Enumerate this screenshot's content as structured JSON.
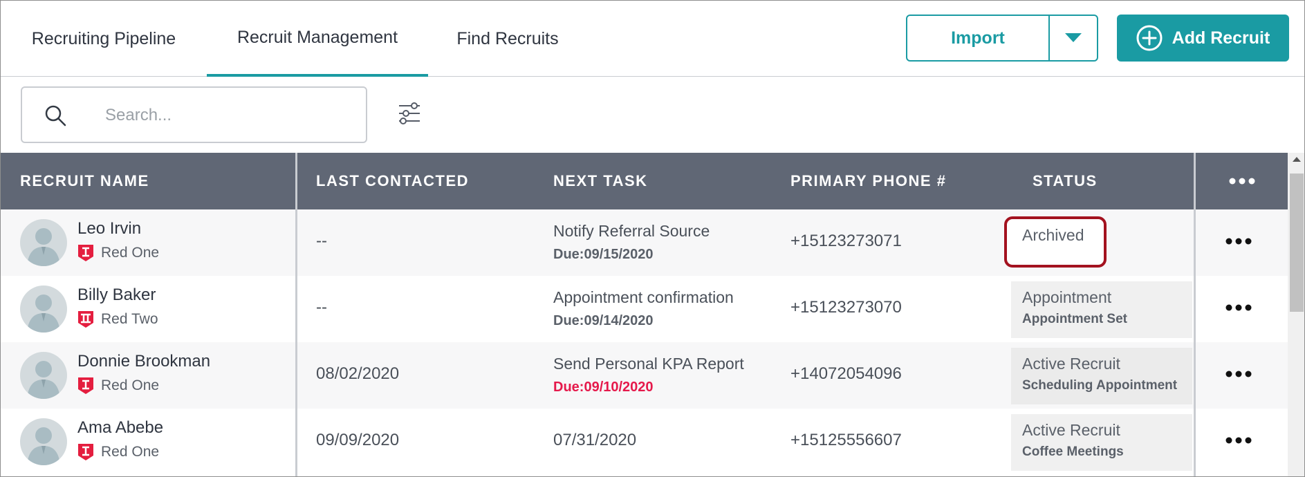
{
  "tabs": [
    {
      "label": "Recruiting Pipeline"
    },
    {
      "label": "Recruit Management"
    },
    {
      "label": "Find Recruits"
    }
  ],
  "actions": {
    "import_label": "Import",
    "add_recruit_label": "Add Recruit"
  },
  "search": {
    "placeholder": "Search...",
    "value": ""
  },
  "table": {
    "headers": {
      "name": "RECRUIT NAME",
      "last_contacted": "LAST CONTACTED",
      "next_task": "NEXT TASK",
      "phone": "PRIMARY PHONE #",
      "status": "STATUS"
    },
    "rows": [
      {
        "name": "Leo Irvin",
        "team": "Red One",
        "team_icon": "team-one-badge-icon",
        "last_contacted": "--",
        "task_title": "Notify Referral Source",
        "task_due": "Due:09/15/2020",
        "phone": "+15123273071",
        "status": "Archived",
        "status_sub": ""
      },
      {
        "name": "Billy Baker",
        "team": "Red Two",
        "team_icon": "team-two-badge-icon",
        "last_contacted": "--",
        "task_title": "Appointment confirmation",
        "task_due": "Due:09/14/2020",
        "phone": "+15123273070",
        "status": "Appointment",
        "status_sub": "Appointment Set"
      },
      {
        "name": "Donnie Brookman",
        "team": "Red One",
        "team_icon": "team-one-badge-icon",
        "last_contacted": "08/02/2020",
        "task_title": "Send Personal KPA Report",
        "task_due": "Due:09/10/2020",
        "task_overdue": true,
        "phone": "+14072054096",
        "status": "Active Recruit",
        "status_sub": "Scheduling Appointment"
      },
      {
        "name": "Ama Abebe",
        "team": "Red One",
        "team_icon": "team-one-badge-icon",
        "last_contacted": "09/09/2020",
        "task_date": "07/31/2020",
        "phone": "+15125556607",
        "status": "Active Recruit",
        "status_sub": "Coffee Meetings"
      }
    ]
  },
  "colors": {
    "accent": "#1a9ba3",
    "header_bg": "#606775",
    "overdue": "#e5194b",
    "highlight": "#a3121f",
    "badge": "#e41e3f"
  },
  "icons": [
    "search-icon",
    "filter-icon",
    "caret-down-icon",
    "plus-circle-icon",
    "more-horizontal-icon",
    "avatar-icon"
  ]
}
